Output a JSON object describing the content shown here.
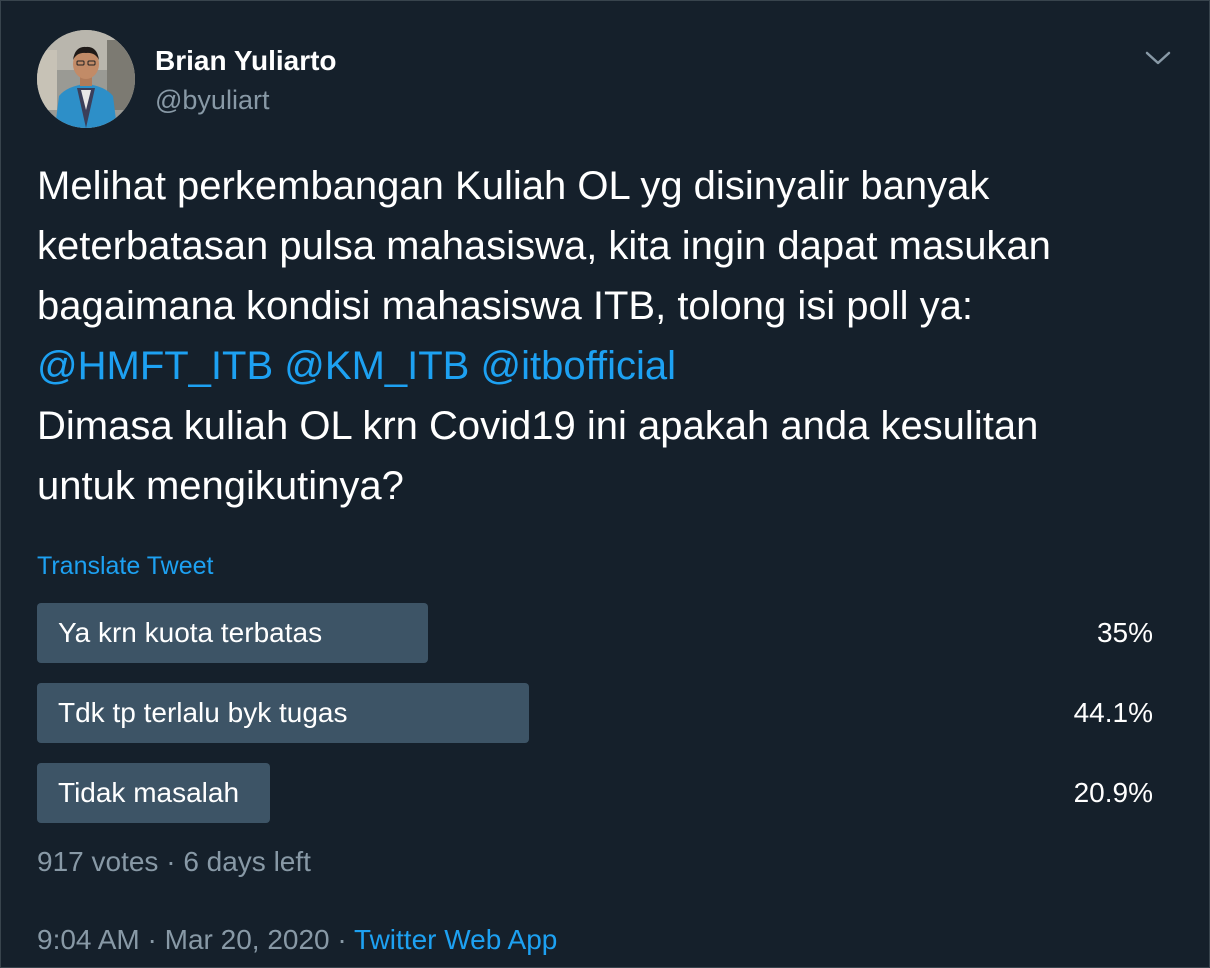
{
  "author": {
    "name": "Brian Yuliarto",
    "handle": "@byuliart"
  },
  "tweet": {
    "line1": "Melihat perkembangan Kuliah OL yg disinyalir banyak",
    "line2": "keterbatasan pulsa mahasiswa, kita ingin dapat masukan",
    "line3": "bagaimana kondisi mahasiswa ITB, tolong isi poll ya:",
    "mentions": [
      "@HMFT_ITB",
      "@KM_ITB",
      "@itbofficial"
    ],
    "line5": "Dimasa kuliah OL krn Covid19 ini apakah anda kesulitan",
    "line6": "untuk mengikutinya?"
  },
  "translate_label": "Translate Tweet",
  "poll": {
    "options": [
      {
        "label": "Ya krn kuota terbatas",
        "percent_text": "35%",
        "percent": 35.0
      },
      {
        "label": "Tdk tp terlalu byk tugas",
        "percent_text": "44.1%",
        "percent": 44.1
      },
      {
        "label": "Tidak masalah",
        "percent_text": "20.9%",
        "percent": 20.9
      }
    ],
    "votes": "917 votes",
    "time_left": "6 days left"
  },
  "meta": {
    "time": "9:04 AM",
    "date": "Mar 20, 2020",
    "source": "Twitter Web App"
  },
  "colors": {
    "background": "#15202b",
    "accent": "#1da1f2",
    "secondary_text": "#8899a6",
    "poll_bar": "#3d5466"
  },
  "icons": {
    "caret": "chevron-down-icon"
  }
}
